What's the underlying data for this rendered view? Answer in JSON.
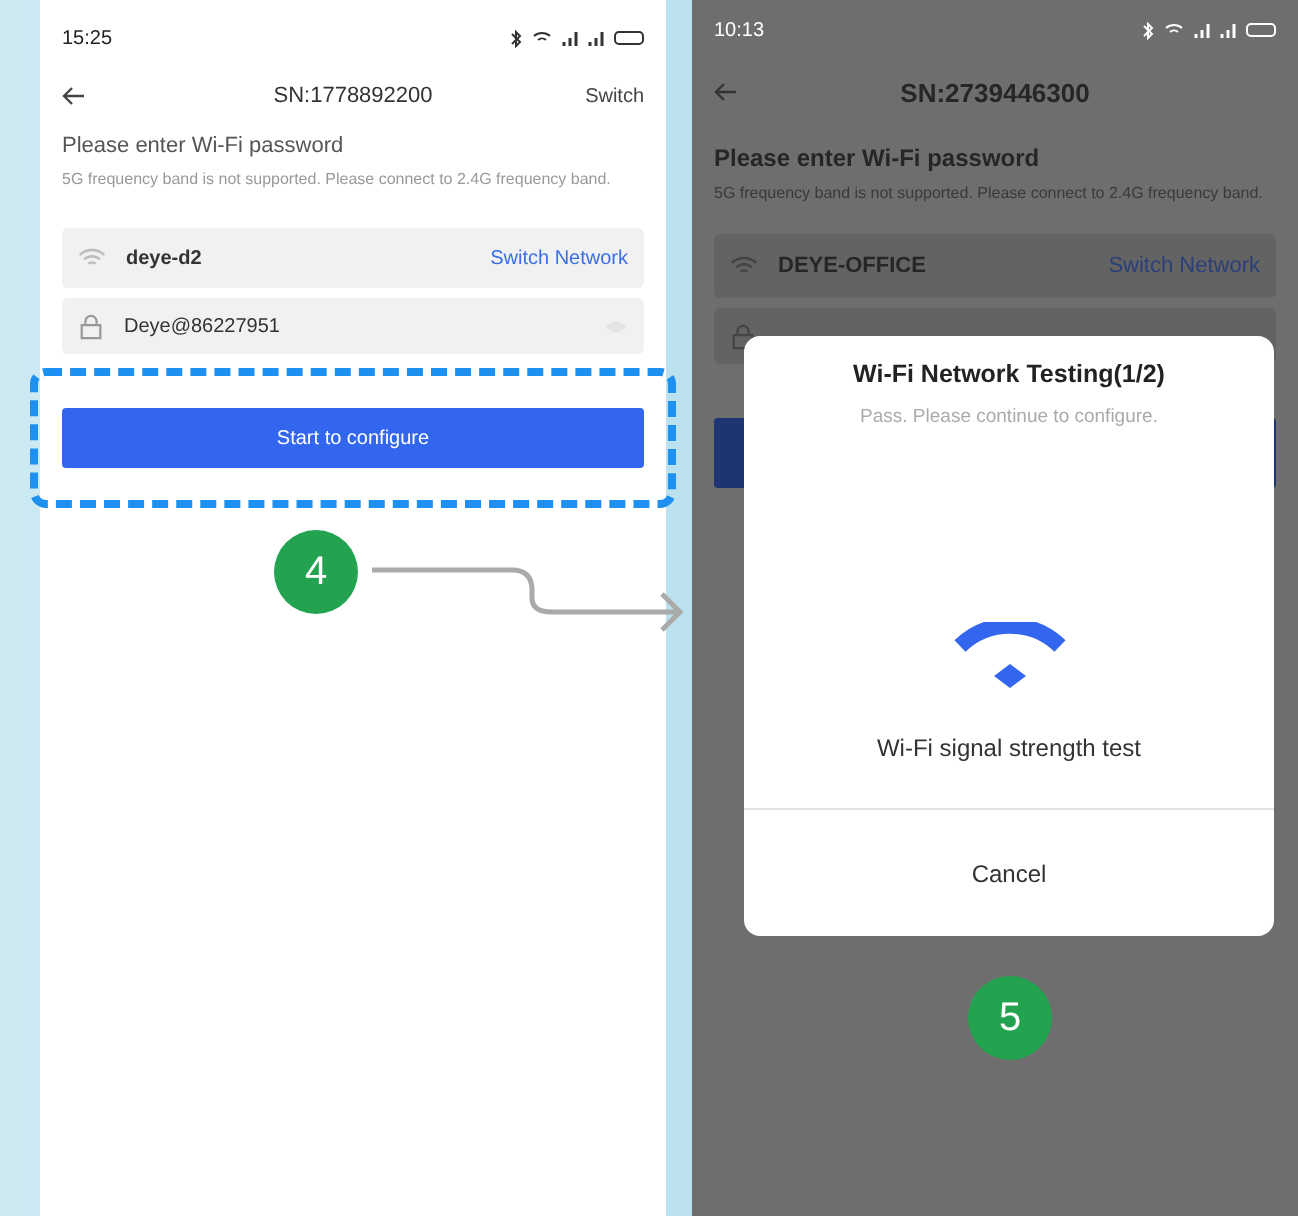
{
  "screens": [
    {
      "dimmed": false,
      "time": "15:25",
      "header": {
        "title": "SN:1778892200",
        "action": "Switch"
      },
      "heading": "Please enter Wi-Fi password",
      "hint": "5G frequency band is not supported. Please connect to 2.4G frequency band.",
      "network": {
        "name": "deye-d2",
        "link": "Switch Network"
      },
      "password": {
        "value": "Deye@86227951"
      },
      "button": {
        "label": "Start to configure",
        "highlighted": true
      }
    },
    {
      "dimmed": true,
      "time": "10:13",
      "header": {
        "title": "SN:2739446300"
      },
      "heading": "Please enter Wi-Fi password",
      "hint": "5G frequency band is not supported. Please connect to 2.4G frequency band.",
      "network": {
        "name": "DEYE-OFFICE",
        "link": "Switch Network"
      },
      "button": {
        "highlighted": false
      }
    }
  ],
  "dialog": {
    "title": "Wi-Fi Network Testing(1/2)",
    "subtitle": "Pass. Please continue to configure.",
    "label": "Wi-Fi signal strength test",
    "cancel": "Cancel"
  },
  "steps": [
    "4",
    "5"
  ]
}
